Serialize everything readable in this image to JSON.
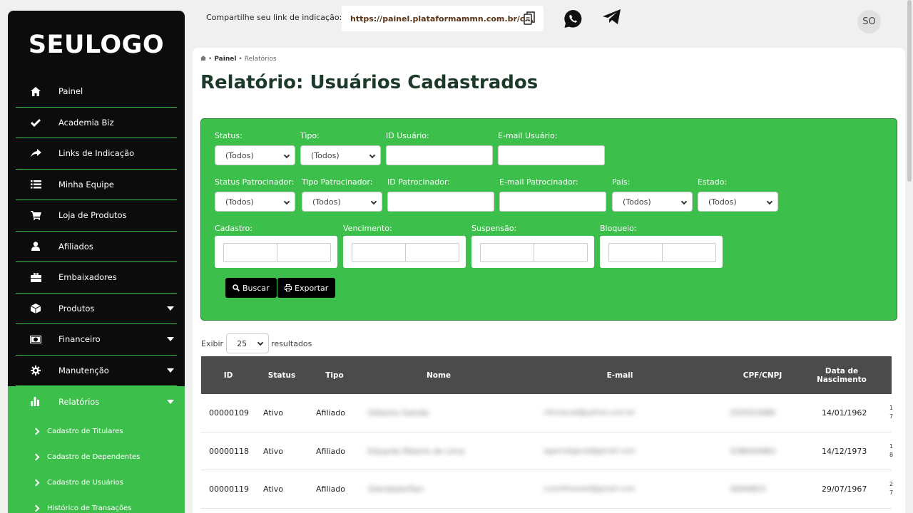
{
  "sidebar": {
    "logo": "SEULOGO",
    "items": [
      {
        "label": "Painel",
        "icon": "home-icon"
      },
      {
        "label": "Academia Biz",
        "icon": "check-icon"
      },
      {
        "label": "Links de Indicação",
        "icon": "share-icon"
      },
      {
        "label": "Minha Equipe",
        "icon": "list-icon"
      },
      {
        "label": "Loja de Produtos",
        "icon": "cart-icon"
      },
      {
        "label": "Afiliados",
        "icon": "user-icon"
      },
      {
        "label": "Embaixadores",
        "icon": "briefcase-icon"
      },
      {
        "label": "Produtos",
        "icon": "box-icon"
      },
      {
        "label": "Financeiro",
        "icon": "money-icon"
      },
      {
        "label": "Manutenção",
        "icon": "gear-icon"
      },
      {
        "label": "Relatórios",
        "icon": "bar-chart-icon"
      }
    ],
    "submenu": [
      "Cadastro de Titulares",
      "Cadastro de Dependentes",
      "Cadastro de Usuários",
      "Histórico de Transações"
    ]
  },
  "topbar": {
    "share_label": "Compartilhe seu link de indicação:",
    "share_url": "https://painel.plataformammn.com.br/c...",
    "avatar": "SO"
  },
  "breadcrumb": {
    "home": "Painel",
    "current": "Relatórios"
  },
  "page_title": "Relatório: Usuários Cadastrados",
  "filters": {
    "status": {
      "label": "Status:",
      "value": "(Todos)"
    },
    "tipo": {
      "label": "Tipo:",
      "value": "(Todos)"
    },
    "id_usuario": {
      "label": "ID Usuário:"
    },
    "email_usuario": {
      "label": "E-mail Usuário:"
    },
    "status_patrocinador": {
      "label": "Status Patrocinador:",
      "value": "(Todos)"
    },
    "tipo_patrocinador": {
      "label": "Tipo Patrocinador:",
      "value": "(Todos)"
    },
    "id_patrocinador": {
      "label": "ID Patrocinador:"
    },
    "email_patrocinador": {
      "label": "E-mail Patrocinador:"
    },
    "pais": {
      "label": "País:",
      "value": "(Todos)"
    },
    "estado": {
      "label": "Estado:",
      "value": "(Todos)"
    },
    "cadastro": {
      "label": "Cadastro:"
    },
    "vencimento": {
      "label": "Vencimento:"
    },
    "suspensao": {
      "label": "Suspensão:"
    },
    "bloqueio": {
      "label": "Bloqueio:"
    },
    "buscar": "Buscar",
    "exportar": "Exportar"
  },
  "results": {
    "show_label": "Exibir",
    "page_size": "25",
    "suffix": "resultados"
  },
  "table": {
    "headers": [
      "ID",
      "Status",
      "Tipo",
      "Nome",
      "E-mail",
      "CPF/CNPJ",
      "Data de Nascimento"
    ],
    "rows": [
      {
        "id": "00000109",
        "status": "Ativo",
        "tipo": "Afiliado",
        "nome": "Gilberto Galvão",
        "email": "ciliceacad@yahoo.com.br",
        "doc": "033553480",
        "nascimento": "14/01/1962",
        "cut": "1 7"
      },
      {
        "id": "00000118",
        "status": "Ativo",
        "tipo": "Afiliado",
        "nome": "Eduardo Ribeiro de Lima",
        "email": "agarrubgaval@gmail.com",
        "doc": "038044983",
        "nascimento": "14/12/1973",
        "cut": "1 8"
      },
      {
        "id": "00000119",
        "status": "Ativo",
        "tipo": "Afiliado",
        "nome": "Glendadorflan",
        "email": "cusrofresosel@gmail.com",
        "doc": "0004853",
        "nascimento": "29/07/1967",
        "cut": "2 7"
      }
    ]
  },
  "colors": {
    "green": "#3dc04b",
    "sidebar": "#0c0c0c",
    "header": "#4b4b4b",
    "title": "#1b3a2a"
  }
}
